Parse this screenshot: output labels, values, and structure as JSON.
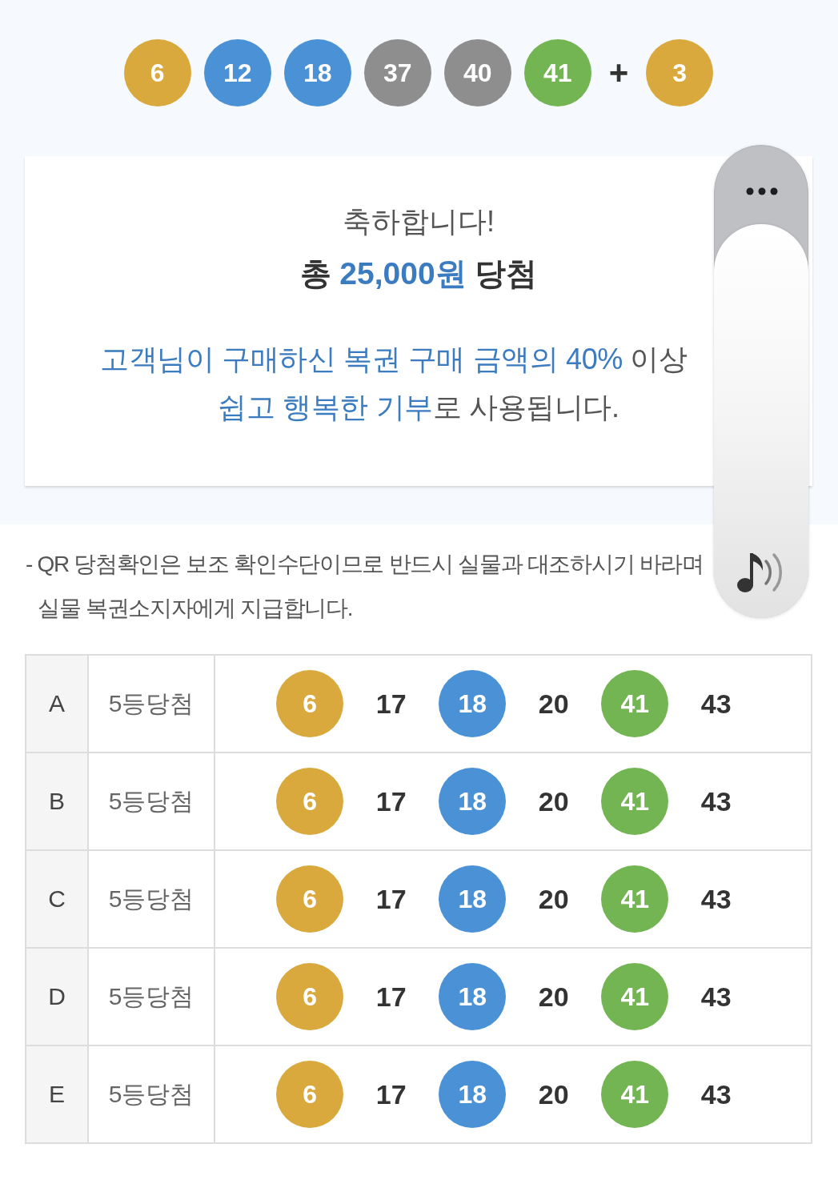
{
  "winning_numbers": {
    "balls": [
      {
        "value": "6",
        "color": "#d9a93e"
      },
      {
        "value": "12",
        "color": "#4a91d5"
      },
      {
        "value": "18",
        "color": "#4a91d5"
      },
      {
        "value": "37",
        "color": "#8e8e8e"
      },
      {
        "value": "40",
        "color": "#8e8e8e"
      },
      {
        "value": "41",
        "color": "#73b453"
      }
    ],
    "plus": "+",
    "bonus": {
      "value": "3",
      "color": "#d9a93e"
    }
  },
  "result_card": {
    "greeting": "축하합니다!",
    "prize": [
      {
        "text": "총 ",
        "highlight": false
      },
      {
        "text": "25,000원",
        "highlight": true
      },
      {
        "text": " 당첨",
        "highlight": false
      }
    ],
    "message_lines": [
      {
        "segments": [
          {
            "text": "고객님이 구매하신 복권 구매 금액의 40%",
            "highlight": true
          },
          {
            "text": " 이상",
            "highlight": false
          }
        ]
      },
      {
        "segments": [
          {
            "text": "쉽고 행복한 기부",
            "highlight": true
          },
          {
            "text": "로 사용됩니다.",
            "highlight": false
          }
        ]
      }
    ]
  },
  "notice_lines": [
    "- QR 당첨확인은 보조 확인수단이므로 반드시 실물과 대조하시기 바라며",
    "실물 복권소지자에게 지급합니다."
  ],
  "games": [
    {
      "label": "A",
      "result": "5등당첨",
      "numbers": [
        {
          "value": "6",
          "matched": true,
          "color": "#d9a93e"
        },
        {
          "value": "17",
          "matched": false
        },
        {
          "value": "18",
          "matched": true,
          "color": "#4a91d5"
        },
        {
          "value": "20",
          "matched": false
        },
        {
          "value": "41",
          "matched": true,
          "color": "#73b453"
        },
        {
          "value": "43",
          "matched": false
        }
      ]
    },
    {
      "label": "B",
      "result": "5등당첨",
      "numbers": [
        {
          "value": "6",
          "matched": true,
          "color": "#d9a93e"
        },
        {
          "value": "17",
          "matched": false
        },
        {
          "value": "18",
          "matched": true,
          "color": "#4a91d5"
        },
        {
          "value": "20",
          "matched": false
        },
        {
          "value": "41",
          "matched": true,
          "color": "#73b453"
        },
        {
          "value": "43",
          "matched": false
        }
      ]
    },
    {
      "label": "C",
      "result": "5등당첨",
      "numbers": [
        {
          "value": "6",
          "matched": true,
          "color": "#d9a93e"
        },
        {
          "value": "17",
          "matched": false
        },
        {
          "value": "18",
          "matched": true,
          "color": "#4a91d5"
        },
        {
          "value": "20",
          "matched": false
        },
        {
          "value": "41",
          "matched": true,
          "color": "#73b453"
        },
        {
          "value": "43",
          "matched": false
        }
      ]
    },
    {
      "label": "D",
      "result": "5등당첨",
      "numbers": [
        {
          "value": "6",
          "matched": true,
          "color": "#d9a93e"
        },
        {
          "value": "17",
          "matched": false
        },
        {
          "value": "18",
          "matched": true,
          "color": "#4a91d5"
        },
        {
          "value": "20",
          "matched": false
        },
        {
          "value": "41",
          "matched": true,
          "color": "#73b453"
        },
        {
          "value": "43",
          "matched": false
        }
      ]
    },
    {
      "label": "E",
      "result": "5등당첨",
      "numbers": [
        {
          "value": "6",
          "matched": true,
          "color": "#d9a93e"
        },
        {
          "value": "17",
          "matched": false
        },
        {
          "value": "18",
          "matched": true,
          "color": "#4a91d5"
        },
        {
          "value": "20",
          "matched": false
        },
        {
          "value": "41",
          "matched": true,
          "color": "#73b453"
        },
        {
          "value": "43",
          "matched": false
        }
      ]
    }
  ]
}
